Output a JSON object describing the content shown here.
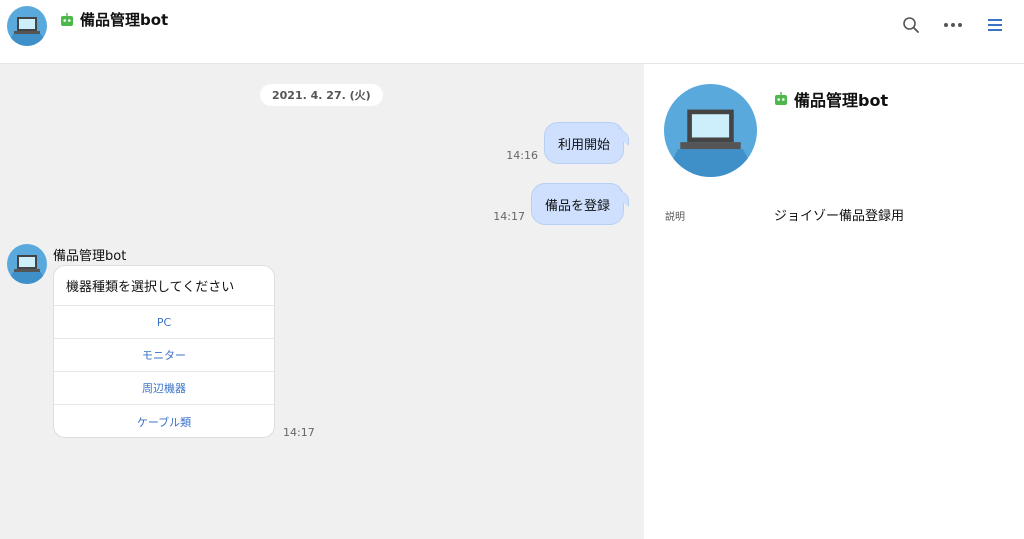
{
  "header": {
    "title": "備品管理bot",
    "icons": [
      "search-icon",
      "more-icon",
      "menu-icon"
    ],
    "accent_color": "#3a72c8",
    "bot_icon_color": "#4cb84c"
  },
  "chat": {
    "date": "2021. 4. 27. (火)",
    "messages": [
      {
        "text": "利用開始",
        "time": "14:16"
      },
      {
        "text": "備品を登録",
        "time": "14:17"
      }
    ],
    "incoming": {
      "sender": "備品管理bot",
      "card_title": "機器種類を選択してください",
      "options": [
        "PC",
        "モニター",
        "周辺機器",
        "ケーブル類"
      ],
      "time": "14:17"
    }
  },
  "profile": {
    "name": "備品管理bot",
    "description_label": "説明",
    "description_value": "ジョイゾー備品登録用"
  }
}
